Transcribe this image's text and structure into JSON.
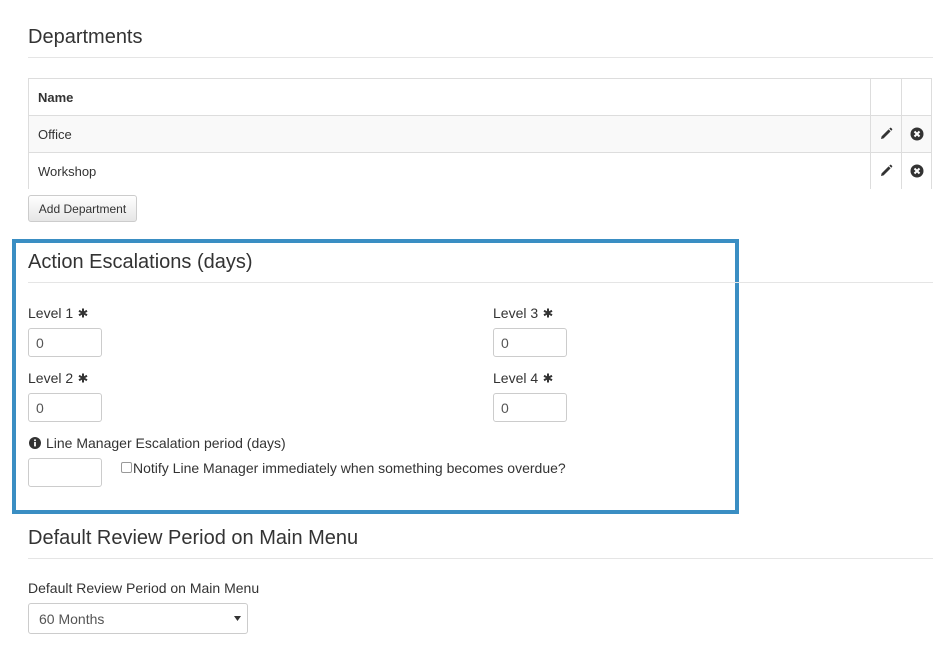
{
  "departments": {
    "title": "Departments",
    "table": {
      "header": "Name",
      "rows": [
        {
          "name": "Office"
        },
        {
          "name": "Workshop"
        }
      ]
    },
    "add_button": "Add Department"
  },
  "escalations": {
    "title": "Action Escalations (days)",
    "level1": {
      "label": "Level 1",
      "value": "0"
    },
    "level2": {
      "label": "Level 2",
      "value": "0"
    },
    "level3": {
      "label": "Level 3",
      "value": "0"
    },
    "level4": {
      "label": "Level 4",
      "value": "0"
    },
    "line_manager": {
      "label": "Line Manager Escalation period (days)",
      "value": ""
    },
    "notify": {
      "label": "Notify Line Manager immediately when something becomes overdue?",
      "checked": false
    },
    "highlight_color": "#3a8ec3"
  },
  "review": {
    "title": "Default Review Period on Main Menu",
    "label": "Default Review Period on Main Menu",
    "selected": "60 Months"
  },
  "icons": {
    "edit": "pencil-icon",
    "delete": "remove-circle-icon",
    "required": "asterisk-icon",
    "info": "info-icon",
    "dropdown": "caret-down-icon"
  }
}
